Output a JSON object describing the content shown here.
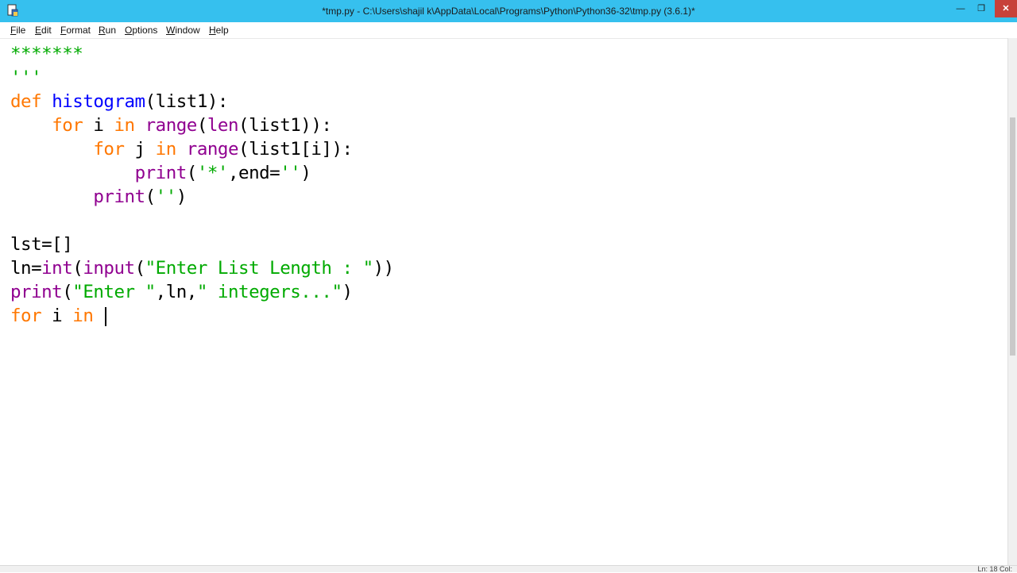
{
  "window": {
    "title": "*tmp.py - C:\\Users\\shajil k\\AppData\\Local\\Programs\\Python\\Python36-32\\tmp.py (3.6.1)*",
    "app_icon": "idle-file-icon",
    "minimize_label": "—",
    "maximize_label": "❐",
    "close_label": "✕",
    "titlebar_color": "#36c0ee",
    "close_color": "#c7413a"
  },
  "menu": {
    "items": [
      {
        "label": "File",
        "mnemonic": "F",
        "rest": "ile"
      },
      {
        "label": "Edit",
        "mnemonic": "E",
        "rest": "dit"
      },
      {
        "label": "Format",
        "mnemonic": "F",
        "rest": "ormat",
        "pre": ""
      },
      {
        "label": "Run",
        "mnemonic": "R",
        "rest": "un"
      },
      {
        "label": "Options",
        "mnemonic": "O",
        "rest": "ptions"
      },
      {
        "label": "Window",
        "mnemonic": "W",
        "rest": "indow"
      },
      {
        "label": "Help",
        "mnemonic": "H",
        "rest": "elp"
      }
    ]
  },
  "editor": {
    "lines": [
      [
        {
          "t": "*******",
          "c": "str"
        }
      ],
      [
        {
          "t": "'''",
          "c": "str"
        }
      ],
      [
        {
          "t": "def",
          "c": "kw"
        },
        {
          "t": " ",
          "c": "txt"
        },
        {
          "t": "histogram",
          "c": "def"
        },
        {
          "t": "(list1):",
          "c": "txt"
        }
      ],
      [
        {
          "t": "    ",
          "c": "txt"
        },
        {
          "t": "for",
          "c": "kw"
        },
        {
          "t": " i ",
          "c": "txt"
        },
        {
          "t": "in",
          "c": "kw"
        },
        {
          "t": " ",
          "c": "txt"
        },
        {
          "t": "range",
          "c": "bi"
        },
        {
          "t": "(",
          "c": "txt"
        },
        {
          "t": "len",
          "c": "bi"
        },
        {
          "t": "(list1)):",
          "c": "txt"
        }
      ],
      [
        {
          "t": "        ",
          "c": "txt"
        },
        {
          "t": "for",
          "c": "kw"
        },
        {
          "t": " j ",
          "c": "txt"
        },
        {
          "t": "in",
          "c": "kw"
        },
        {
          "t": " ",
          "c": "txt"
        },
        {
          "t": "range",
          "c": "bi"
        },
        {
          "t": "(list1[i]):",
          "c": "txt"
        }
      ],
      [
        {
          "t": "            ",
          "c": "txt"
        },
        {
          "t": "print",
          "c": "bi"
        },
        {
          "t": "(",
          "c": "txt"
        },
        {
          "t": "'*'",
          "c": "str"
        },
        {
          "t": ",end=",
          "c": "txt"
        },
        {
          "t": "''",
          "c": "str"
        },
        {
          "t": ")",
          "c": "txt"
        }
      ],
      [
        {
          "t": "        ",
          "c": "txt"
        },
        {
          "t": "print",
          "c": "bi"
        },
        {
          "t": "(",
          "c": "txt"
        },
        {
          "t": "''",
          "c": "str"
        },
        {
          "t": ")",
          "c": "txt"
        }
      ],
      [],
      [
        {
          "t": "lst=[]",
          "c": "txt"
        }
      ],
      [
        {
          "t": "ln=",
          "c": "txt"
        },
        {
          "t": "int",
          "c": "bi"
        },
        {
          "t": "(",
          "c": "txt"
        },
        {
          "t": "input",
          "c": "bi"
        },
        {
          "t": "(",
          "c": "txt"
        },
        {
          "t": "\"Enter List Length : \"",
          "c": "str"
        },
        {
          "t": "))",
          "c": "txt"
        }
      ],
      [
        {
          "t": "print",
          "c": "bi"
        },
        {
          "t": "(",
          "c": "txt"
        },
        {
          "t": "\"Enter \"",
          "c": "str"
        },
        {
          "t": ",ln,",
          "c": "txt"
        },
        {
          "t": "\" integers...\"",
          "c": "str"
        },
        {
          "t": ")",
          "c": "txt"
        }
      ],
      [
        {
          "t": "for",
          "c": "kw"
        },
        {
          "t": " i ",
          "c": "txt"
        },
        {
          "t": "in",
          "c": "kw"
        },
        {
          "t": " ",
          "c": "txt"
        }
      ]
    ],
    "caret_line": 11
  },
  "status": {
    "text": "Ln: 18  Col:"
  }
}
